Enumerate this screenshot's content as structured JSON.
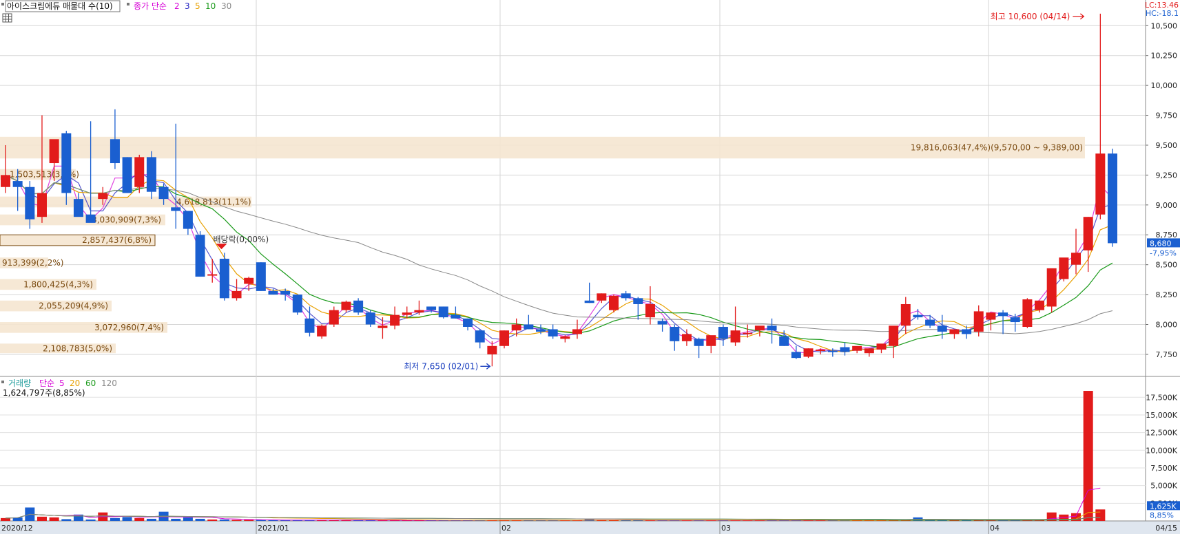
{
  "price_legend": {
    "title": "아이스크림에듀 매물대 수(10)",
    "ma_label": "종가 단순",
    "ma_periods": [
      "2",
      "3",
      "5",
      "10",
      "30"
    ],
    "ma_colors": [
      "#d600d6",
      "#2020c0",
      "#e8a000",
      "#1a9a1a",
      "#888888"
    ]
  },
  "volume_legend": {
    "title": "거래량",
    "ma_label": "단순",
    "ma_periods": [
      "5",
      "20",
      "60",
      "120"
    ],
    "ma_colors": [
      "#d600d6",
      "#e8a000",
      "#1a9a1a",
      "#888888"
    ],
    "current": "1,624,797주(8,85%)"
  },
  "corner": {
    "lc": "LC:13.46",
    "hc": "HC:-18.1"
  },
  "annotations": {
    "high": "최고 10,600 (04/14)",
    "low": "최저 7,650 (02/01)",
    "dividend": "배당락(0,00%)"
  },
  "current_price": {
    "value": "8,680",
    "change": "-7,95%"
  },
  "current_volume": {
    "value": "1,625K",
    "ratio": "8,85%"
  },
  "colors": {
    "up": "#e21b1b",
    "down": "#1a5fd0",
    "band": "#f5e6d0",
    "band_text": "#7a4a10"
  },
  "chart_data": [
    {
      "type": "candlestick",
      "title": "아이스크림에듀 매물대 수(10)",
      "x_labels": [
        "2020/12",
        "2021/01",
        "02",
        "03",
        "04",
        "04/15"
      ],
      "y_ticks": [
        "10,500",
        "10,250",
        "10,000",
        "9,750",
        "9,500",
        "9,250",
        "9,000",
        "8,750",
        "8,500",
        "8,250",
        "8,000",
        "7,750"
      ],
      "ylim": [
        7600,
        10680
      ],
      "ohlc": [
        [
          9150,
          9500,
          9100,
          9250
        ],
        [
          9200,
          9300,
          8950,
          9150
        ],
        [
          9150,
          9200,
          8800,
          8880
        ],
        [
          8900,
          9750,
          8850,
          9100
        ],
        [
          9350,
          9500,
          9200,
          9550
        ],
        [
          9600,
          9620,
          9000,
          9100
        ],
        [
          9050,
          9100,
          8920,
          8900
        ],
        [
          8920,
          9700,
          8900,
          8850
        ],
        [
          9050,
          9150,
          9000,
          9100
        ],
        [
          9550,
          9800,
          9300,
          9350
        ],
        [
          9400,
          9400,
          9100,
          9100
        ],
        [
          9150,
          9420,
          9100,
          9400
        ],
        [
          9400,
          9450,
          9050,
          9110
        ],
        [
          9150,
          9180,
          9000,
          9050
        ],
        [
          8980,
          9680,
          8800,
          8950
        ],
        [
          8950,
          8950,
          8750,
          8800
        ],
        [
          8750,
          8780,
          8400,
          8400
        ],
        [
          8420,
          8550,
          8350,
          8420
        ],
        [
          8550,
          8600,
          8200,
          8220
        ],
        [
          8220,
          8380,
          8200,
          8280
        ],
        [
          8340,
          8400,
          8280,
          8390
        ],
        [
          8520,
          8520,
          8280,
          8280
        ],
        [
          8280,
          8300,
          8250,
          8250
        ],
        [
          8280,
          8300,
          8200,
          8250
        ],
        [
          8250,
          8250,
          8080,
          8100
        ],
        [
          8050,
          8150,
          7900,
          7930
        ],
        [
          7900,
          8000,
          7880,
          7990
        ],
        [
          8000,
          8150,
          7980,
          8120
        ],
        [
          8120,
          8200,
          8100,
          8190
        ],
        [
          8200,
          8220,
          8080,
          8100
        ],
        [
          8100,
          8120,
          7980,
          8000
        ],
        [
          7970,
          8060,
          7880,
          7990
        ],
        [
          7990,
          8150,
          7960,
          8080
        ],
        [
          8080,
          8150,
          8050,
          8100
        ],
        [
          8100,
          8200,
          8080,
          8120
        ],
        [
          8150,
          8150,
          8100,
          8120
        ],
        [
          8150,
          8150,
          8050,
          8060
        ],
        [
          8080,
          8150,
          8050,
          8050
        ],
        [
          8050,
          8050,
          7950,
          7980
        ],
        [
          7950,
          7960,
          7800,
          7850
        ],
        [
          7750,
          7860,
          7650,
          7820
        ],
        [
          7820,
          7950,
          7800,
          7950
        ],
        [
          7950,
          8050,
          7900,
          8000
        ],
        [
          8000,
          8080,
          7960,
          7960
        ],
        [
          7960,
          8000,
          7920,
          7940
        ],
        [
          7960,
          8000,
          7880,
          7900
        ],
        [
          7880,
          7910,
          7850,
          7900
        ],
        [
          7920,
          8040,
          7880,
          7960
        ],
        [
          8200,
          8350,
          8180,
          8180
        ],
        [
          8200,
          8260,
          8180,
          8260
        ],
        [
          8120,
          8250,
          8100,
          8240
        ],
        [
          8260,
          8280,
          8200,
          8220
        ],
        [
          8220,
          8230,
          8040,
          8170
        ],
        [
          8060,
          8320,
          8000,
          8170
        ],
        [
          8030,
          8050,
          7940,
          8000
        ],
        [
          7980,
          8000,
          7780,
          7860
        ],
        [
          7860,
          7960,
          7820,
          7920
        ],
        [
          7880,
          7890,
          7720,
          7820
        ],
        [
          7820,
          7870,
          7760,
          7910
        ],
        [
          7980,
          8000,
          7820,
          7880
        ],
        [
          7850,
          8150,
          7820,
          7950
        ],
        [
          7930,
          8000,
          7890,
          7930
        ],
        [
          7950,
          7960,
          7900,
          7990
        ],
        [
          7990,
          8050,
          7840,
          7950
        ],
        [
          7900,
          7950,
          7820,
          7820
        ],
        [
          7770,
          7820,
          7710,
          7720
        ],
        [
          7730,
          7800,
          7720,
          7800
        ],
        [
          7780,
          7800,
          7750,
          7790
        ],
        [
          7780,
          7800,
          7730,
          7770
        ],
        [
          7810,
          7850,
          7740,
          7770
        ],
        [
          7780,
          7800,
          7760,
          7820
        ],
        [
          7760,
          7800,
          7730,
          7800
        ],
        [
          7790,
          7830,
          7760,
          7840
        ],
        [
          7820,
          7830,
          7720,
          7990
        ],
        [
          7990,
          8230,
          7920,
          8170
        ],
        [
          8080,
          8130,
          8040,
          8060
        ],
        [
          8040,
          8080,
          7970,
          7990
        ],
        [
          7990,
          8080,
          7880,
          7940
        ],
        [
          7920,
          7960,
          7880,
          7960
        ],
        [
          7960,
          7990,
          7880,
          7920
        ],
        [
          7940,
          8160,
          7900,
          8110
        ],
        [
          8040,
          8100,
          7950,
          8100
        ],
        [
          8100,
          8120,
          7920,
          8070
        ],
        [
          8060,
          8090,
          7940,
          8020
        ],
        [
          7980,
          8220,
          7970,
          8210
        ],
        [
          8120,
          8200,
          8100,
          8200
        ],
        [
          8150,
          8300,
          8100,
          8470
        ],
        [
          8380,
          8520,
          8360,
          8560
        ],
        [
          8500,
          8800,
          8420,
          8600
        ],
        [
          8620,
          8900,
          8440,
          8900
        ],
        [
          8920,
          10600,
          8880,
          9430
        ],
        [
          9430,
          9470,
          8650,
          8680
        ]
      ]
    },
    {
      "type": "volume_profile",
      "ranges": [
        {
          "label": "19,816,063(47,4%)(9,570,00 ~ 9,389,00)",
          "volume": 19816063,
          "pct": 47.4
        },
        {
          "label": "1,503,513(3,6%)",
          "volume": 1503513,
          "pct": 3.6
        },
        {
          "label": "4,618,813(11,1%)",
          "volume": 4618813,
          "pct": 11.1
        },
        {
          "label": "3,030,909(7,3%)",
          "volume": 3030909,
          "pct": 7.3
        },
        {
          "label": "2,857,437(6,8%)",
          "volume": 2857437,
          "pct": 6.8
        },
        {
          "label": "913,399(2,2%)",
          "volume": 913399,
          "pct": 2.2
        },
        {
          "label": "1,800,425(4,3%)",
          "volume": 1800425,
          "pct": 4.3
        },
        {
          "label": "2,055,209(4,9%)",
          "volume": 2055209,
          "pct": 4.9
        },
        {
          "label": "3,072,960(7,4%)",
          "volume": 3072960,
          "pct": 7.4
        },
        {
          "label": "2,108,783(5,0%)",
          "volume": 2108783,
          "pct": 5.0
        }
      ]
    },
    {
      "type": "bar",
      "title": "거래량",
      "y_ticks": [
        "17,500K",
        "15,000K",
        "12,500K",
        "10,000K",
        "7,500K",
        "5,000K",
        "2,500K"
      ],
      "ylim": [
        0,
        18500
      ],
      "values_k": [
        400,
        500,
        1900,
        600,
        500,
        250,
        900,
        200,
        1200,
        400,
        550,
        400,
        300,
        1300,
        300,
        500,
        300,
        200,
        200,
        150,
        150,
        150,
        100,
        100,
        120,
        100,
        150,
        100,
        120,
        100,
        100,
        100,
        100,
        100,
        100,
        100,
        100,
        100,
        100,
        100,
        150,
        120,
        100,
        100,
        100,
        100,
        100,
        100,
        300,
        150,
        100,
        100,
        100,
        100,
        100,
        100,
        100,
        100,
        100,
        100,
        100,
        100,
        100,
        100,
        100,
        100,
        100,
        100,
        100,
        100,
        100,
        100,
        100,
        100,
        100,
        500,
        200,
        100,
        100,
        100,
        100,
        100,
        100,
        100,
        100,
        100,
        1200,
        900,
        1100,
        18400,
        1625
      ]
    }
  ]
}
